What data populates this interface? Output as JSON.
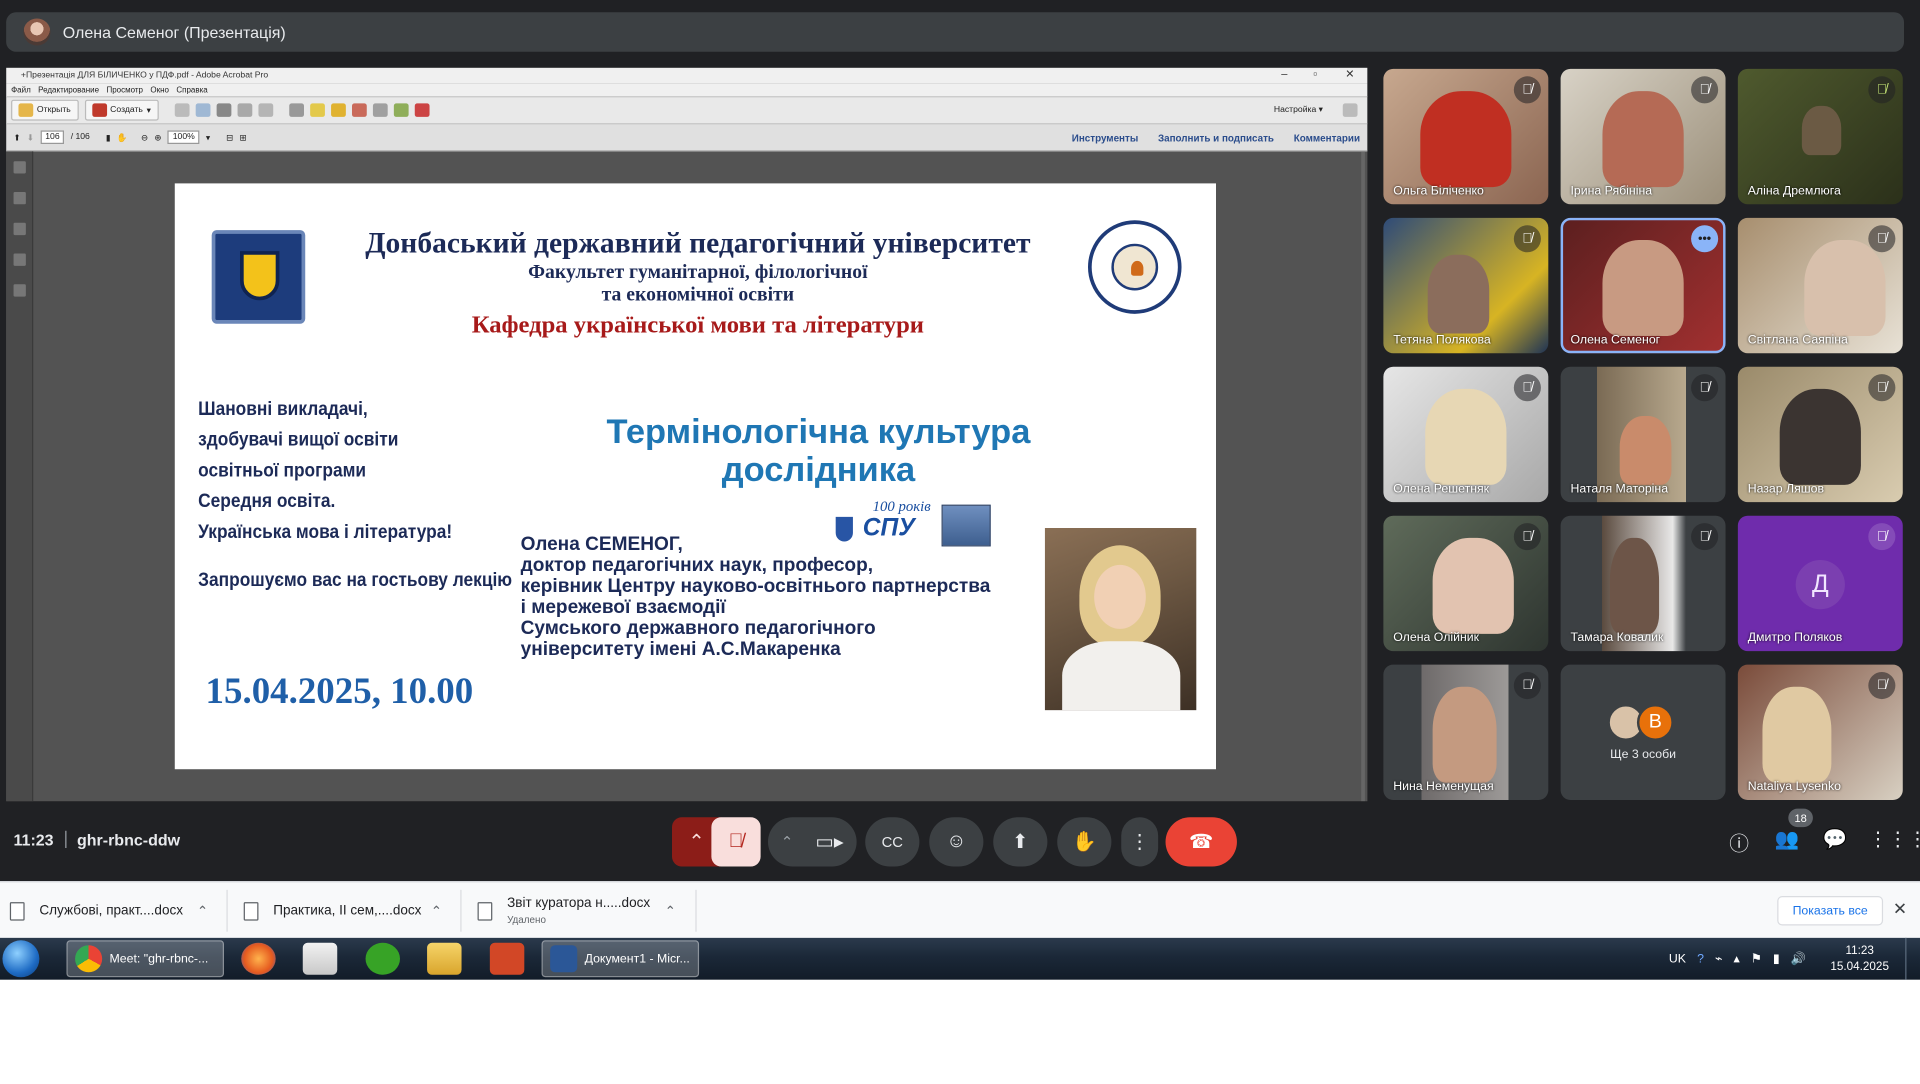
{
  "presenter_bar": {
    "title": "Олена Семеног (Презентація)"
  },
  "acrobat": {
    "window_title": "+Презентація ДЛЯ БІЛИЧЕНКО у ПДФ.pdf - Adobe Acrobat Pro",
    "menu": [
      "Файл",
      "Редактирование",
      "Просмотр",
      "Окно",
      "Справка"
    ],
    "open_label": "Открыть",
    "create_label": "Создать",
    "page_current": "106",
    "page_total": "/ 106",
    "zoom": "100%",
    "customize_label": "Настройка",
    "panels": [
      "Инструменты",
      "Заполнить и подписать",
      "Комментарии"
    ]
  },
  "slide": {
    "university": "Донбаський державний педагогічний університет",
    "faculty_line1": "Факультет гуманітарної, філологічної",
    "faculty_line2": "та економічної освіти",
    "department": "Кафедра української мови та літератури",
    "greeting": [
      "Шановні викладачі,",
      "здобувачі вищої освіти",
      "освітньої програми",
      "Середня освіта.",
      "Українська мова і література!"
    ],
    "invite": "Запрошуємо вас на гостьову лекцію",
    "lecture_title_line1": "Термінологічна культура",
    "lecture_title_line2": "дослідника",
    "speaker": [
      "Олена СЕМЕНОГ,",
      "доктор педагогічних наук, професор,",
      "керівник  Центру науково-освітнього партнерства",
      "і мережевої взаємодії",
      "Сумського державного педагогічного",
      "університету імені А.С.Макаренка"
    ],
    "date": "15.04.2025, 10.00",
    "logo_word": "СПУ",
    "logo_years": "100 років"
  },
  "participants": [
    {
      "name": "Ольга Біліченко",
      "muted": true
    },
    {
      "name": "Ірина Рябініна",
      "muted": true
    },
    {
      "name": "Аліна Дремлюга",
      "muted": true
    },
    {
      "name": "Тетяна Полякова",
      "muted": true
    },
    {
      "name": "Олена Семеног",
      "speaking": true
    },
    {
      "name": "Світлана Саяпіна",
      "muted": true
    },
    {
      "name": "Олена Решетняк",
      "muted": true
    },
    {
      "name": "Наталя Маторіна",
      "muted": true
    },
    {
      "name": "Назар Ляшов",
      "muted": true
    },
    {
      "name": "Олена Олійник",
      "muted": true
    },
    {
      "name": "Тамара Ковалик",
      "muted": true
    },
    {
      "name": "Дмитро Поляков",
      "muted": true,
      "initial": "Д"
    },
    {
      "name": "Нина Неменущая",
      "muted": true
    },
    {
      "name": "Ще 3 особи",
      "initial": "В"
    },
    {
      "name": "Nataliya Lysenko",
      "muted": true
    }
  ],
  "meeting": {
    "time": "11:23",
    "code": "ghr-rbnc-ddw",
    "participant_count": "18"
  },
  "downloads": {
    "items": [
      {
        "name": "Службові, практ....docx",
        "status": ""
      },
      {
        "name": "Практика, ІІ сем,....docx",
        "status": ""
      },
      {
        "name": "Звіт куратора н.....docx",
        "status": "Удалено"
      }
    ],
    "show_all": "Показать все"
  },
  "taskbar": {
    "tasks": [
      "Meet: \"ghr-rbnc-...",
      "Документ1 - Micr..."
    ],
    "lang": "UK",
    "time": "11:23",
    "date": "15.04.2025"
  },
  "colors": {
    "meet_bg": "#202124",
    "end_call": "#ea4335",
    "slide_title": "#1f77b4",
    "department": "#a71a1a"
  }
}
